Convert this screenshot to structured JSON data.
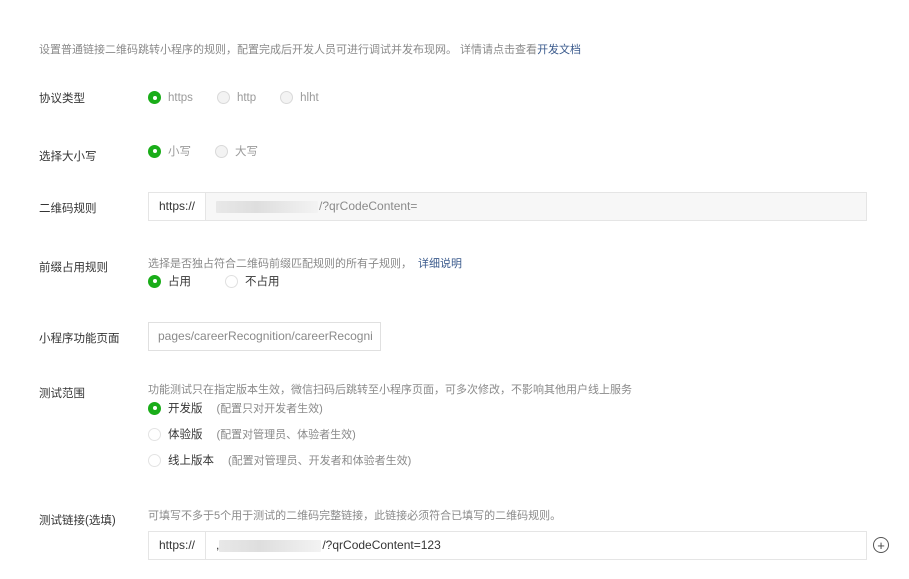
{
  "intro": {
    "text": "设置普通链接二维码跳转小程序的规则，配置完成后开发人员可进行调试并发布现网。 详情请点击查看",
    "link": "开发文档"
  },
  "protocol": {
    "label": "协议类型",
    "options": [
      "https",
      "http",
      "hlht"
    ],
    "selected": "https"
  },
  "case": {
    "label": "选择大小写",
    "options": [
      "小写",
      "大写"
    ],
    "selected": "小写"
  },
  "qr_rule": {
    "label": "二维码规则",
    "prefix": "https://",
    "suffix": "/?qrCodeContent="
  },
  "prefix_rule": {
    "label": "前缀占用规则",
    "desc": "选择是否独占符合二维码前缀匹配规则的所有子规则，",
    "link": "详细说明",
    "options": [
      "占用",
      "不占用"
    ],
    "selected": "占用"
  },
  "page": {
    "label": "小程序功能页面",
    "value": "pages/careerRecognition/careerRecogni"
  },
  "scope": {
    "label": "测试范围",
    "desc": "功能测试只在指定版本生效，微信扫码后跳转至小程序页面，可多次修改，不影响其他用户线上服务",
    "options": [
      {
        "name": "开发版",
        "note": "(配置只对开发者生效)"
      },
      {
        "name": "体验版",
        "note": "(配置对管理员、体验者生效)"
      },
      {
        "name": "线上版本",
        "note": "(配置对管理员、开发者和体验者生效)"
      }
    ],
    "selected": "开发版"
  },
  "test_link": {
    "label": "测试链接(选填)",
    "desc": "可填写不多于5个用于测试的二维码完整链接，此链接必须符合已填写的二维码规则。",
    "prefix": "https://",
    "lead": ",",
    "suffix": "/?qrCodeContent=123"
  },
  "colors": {
    "accent": "#1aad19",
    "link": "#3a5a8c"
  },
  "icons": {
    "add": "plus-circle-icon"
  }
}
